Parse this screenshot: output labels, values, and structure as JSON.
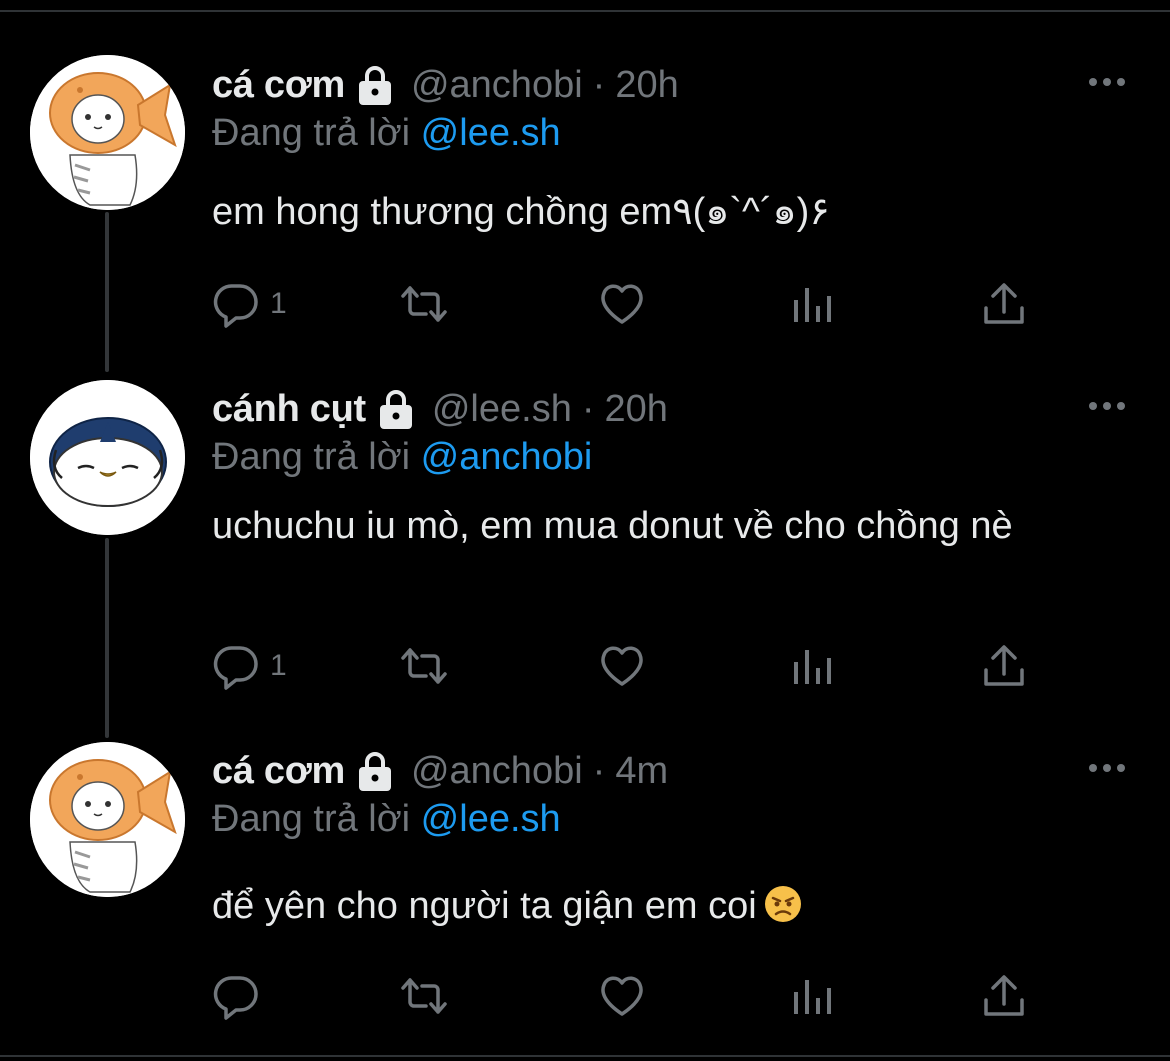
{
  "tweets": [
    {
      "name": "cá cơm",
      "handle": "@anchobi",
      "separator": "·",
      "time": "20h",
      "reply_prefix": "Đang trả lời",
      "reply_to": "@lee.sh",
      "text": "em hong thương chồng em٩(๑`^´๑)۶",
      "reply_count": "1",
      "avatar_icon": "cat-in-fish-icon",
      "locked": true
    },
    {
      "name": "cánh cụt",
      "handle": "@lee.sh",
      "separator": "·",
      "time": "20h",
      "reply_prefix": "Đang trả lời",
      "reply_to": "@anchobi",
      "text": "uchuchu iu mò, em mua donut về cho chồng nè",
      "reply_count": "1",
      "avatar_icon": "penguin-icon",
      "locked": true
    },
    {
      "name": "cá cơm",
      "handle": "@anchobi",
      "separator": "·",
      "time": "4m",
      "reply_prefix": "Đang trả lời",
      "reply_to": "@lee.sh",
      "text": "để yên cho người ta giận em coi",
      "reply_count": "",
      "avatar_icon": "cat-in-fish-icon",
      "locked": true,
      "emoji": "angry-face-icon"
    }
  ],
  "colors": {
    "background": "#000000",
    "primary_text": "#e7e9ea",
    "secondary_text": "#71767b",
    "mention": "#1d9bf0",
    "divider": "#2f3336"
  }
}
